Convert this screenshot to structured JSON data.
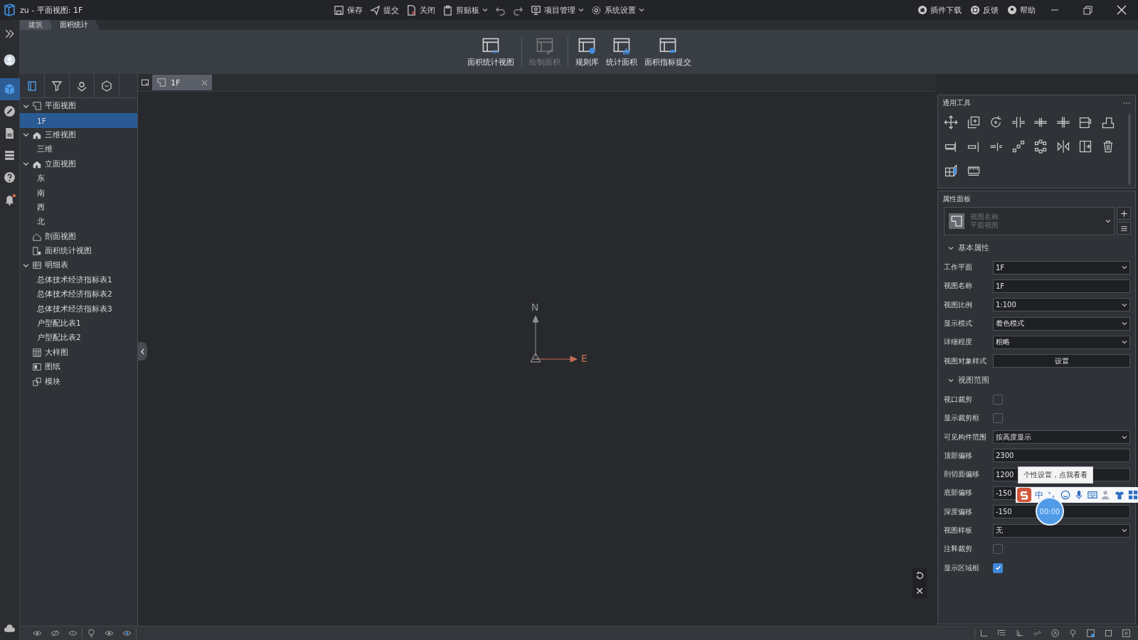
{
  "window": {
    "title": "zu - 平面视图: 1F"
  },
  "toolbar": [
    {
      "kind": "save",
      "label": "保存",
      "has_menu": false
    },
    {
      "kind": "submit",
      "label": "提交",
      "has_menu": false
    },
    {
      "kind": "close",
      "label": "关闭",
      "has_menu": false
    },
    {
      "kind": "clipboard",
      "label": "剪贴板",
      "has_menu": true
    },
    {
      "kind": "undo",
      "has_menu": false
    },
    {
      "kind": "redo",
      "has_menu": false
    },
    {
      "kind": "project",
      "label": "项目管理",
      "has_menu": true
    },
    {
      "kind": "settings",
      "label": "系统设置",
      "has_menu": true
    }
  ],
  "header_links": [
    {
      "kind": "plugin",
      "label": "插件下载"
    },
    {
      "kind": "feedback",
      "label": "反馈"
    },
    {
      "kind": "help",
      "label": "帮助"
    }
  ],
  "ribbon_tabs": [
    {
      "label": "建筑",
      "selected": false
    },
    {
      "label": "面积统计",
      "selected": true
    }
  ],
  "ribbon_groups": [
    {
      "buttons": [
        {
          "kind": "view",
          "label": "面积统计视图",
          "disabled": false
        }
      ]
    },
    {
      "buttons": [
        {
          "kind": "draw",
          "label": "绘制面积",
          "disabled": true
        }
      ]
    },
    {
      "buttons": [
        {
          "kind": "rules",
          "label": "规则库",
          "disabled": false
        },
        {
          "kind": "stats",
          "label": "统计面积",
          "disabled": false
        },
        {
          "kind": "upload",
          "label": "面积指标提交",
          "disabled": false
        }
      ]
    }
  ],
  "doc_tabs": [
    {
      "label": "1F",
      "selected": true
    }
  ],
  "tree": [
    {
      "label": "平面视图",
      "kind": "plan",
      "expanded": true,
      "selected": false,
      "children": [
        {
          "label": "1F",
          "selected": true
        }
      ]
    },
    {
      "label": "三维视图",
      "kind": "house",
      "expanded": true,
      "selected": false,
      "children": [
        {
          "label": "三维",
          "selected": false
        }
      ]
    },
    {
      "label": "立面视图",
      "kind": "house",
      "expanded": true,
      "selected": false,
      "children": [
        {
          "label": "东",
          "selected": false
        },
        {
          "label": "南",
          "selected": false
        },
        {
          "label": "西",
          "selected": false
        },
        {
          "label": "北",
          "selected": false
        }
      ]
    },
    {
      "label": "剖面视图",
      "kind": "section",
      "selected": false
    },
    {
      "label": "面积统计视图",
      "kind": "area",
      "selected": false
    },
    {
      "label": "明细表",
      "kind": "table",
      "expanded": true,
      "selected": false,
      "children": [
        {
          "label": "总体技术经济指标表1",
          "selected": false
        },
        {
          "label": "总体技术经济指标表2",
          "selected": false
        },
        {
          "label": "总体技术经济指标表3",
          "selected": false
        },
        {
          "label": "户型配比表1",
          "selected": false
        },
        {
          "label": "户型配比表2",
          "selected": false
        }
      ]
    },
    {
      "label": "大样图",
      "kind": "detail",
      "selected": false
    },
    {
      "label": "图纸",
      "kind": "sheet",
      "selected": false
    },
    {
      "label": "模块",
      "kind": "module",
      "selected": false
    }
  ],
  "canvas": {
    "north_label": "N",
    "east_label": "E"
  },
  "tools_panel": {
    "title": "通用工具"
  },
  "property_panel": {
    "title": "属性面板",
    "type_selector": {
      "name_label": "视图名称",
      "type_label": "平面视图"
    },
    "sections": [
      {
        "title": "基本属性",
        "expanded": true,
        "rows": [
          {
            "kind": "select",
            "label": "工作平面",
            "value": "1F"
          },
          {
            "kind": "input",
            "label": "视图名称",
            "value": "1F"
          },
          {
            "kind": "select",
            "label": "视图比例",
            "value": "1:100"
          },
          {
            "kind": "select",
            "label": "显示模式",
            "value": "着色模式"
          },
          {
            "kind": "select",
            "label": "详细程度",
            "value": "粗略"
          },
          {
            "kind": "button",
            "label": "视图对象样式",
            "value": "设置"
          }
        ]
      },
      {
        "title": "视图范围",
        "expanded": true,
        "rows": [
          {
            "kind": "checkbox",
            "label": "视口裁剪",
            "checked": false
          },
          {
            "kind": "checkbox",
            "label": "显示裁剪框",
            "checked": false
          },
          {
            "kind": "select",
            "label": "可见构件范围",
            "value": "按高度显示"
          },
          {
            "kind": "input",
            "label": "顶部偏移",
            "value": "2300"
          },
          {
            "kind": "input",
            "label": "剖切面偏移",
            "value": "1200"
          },
          {
            "kind": "input",
            "label": "底部偏移",
            "value": "-150"
          },
          {
            "kind": "input",
            "label": "深度偏移",
            "value": "-150"
          },
          {
            "kind": "select",
            "label": "视图样板",
            "value": "无"
          },
          {
            "kind": "checkbox",
            "label": "注释裁剪",
            "checked": false
          },
          {
            "kind": "checkbox",
            "label": "显示区域框",
            "checked": true
          }
        ]
      }
    ]
  },
  "tooltip": {
    "text": "个性设置，点我看看"
  },
  "ime_bar": {
    "mode": "中",
    "timer": "00:00"
  }
}
